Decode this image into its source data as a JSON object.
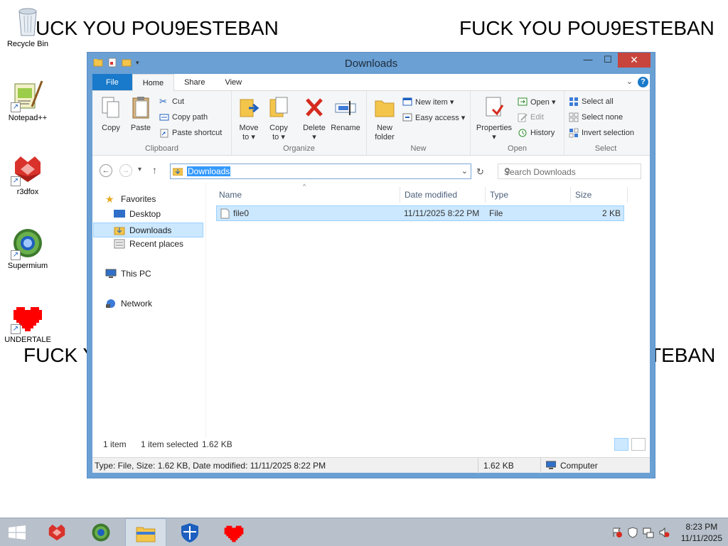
{
  "wallpaper": {
    "line1": "UCK YOU POU9ESTEBAN",
    "line2": "FUCK YOU POU9ESTEBAN",
    "line3": "FUCK Y",
    "line4": "TEBAN"
  },
  "desktop_icons": [
    {
      "label": "Recycle Bin",
      "icon": "recycle-bin-icon"
    },
    {
      "label": "Notepad++",
      "icon": "notepad-plus-plus-icon"
    },
    {
      "label": "r3dfox",
      "icon": "r3dfox-icon"
    },
    {
      "label": "Supermium",
      "icon": "supermium-icon"
    },
    {
      "label": "UNDERTALE",
      "icon": "undertale-heart-icon"
    }
  ],
  "window": {
    "title": "Downloads",
    "minimize": "—",
    "maximize": "☐",
    "close": "✕"
  },
  "ribbon_tabs": [
    "File",
    "Home",
    "Share",
    "View"
  ],
  "ribbon": {
    "clipboard": {
      "label": "Clipboard",
      "copy": "Copy",
      "paste": "Paste",
      "cut": "Cut",
      "copy_path": "Copy path",
      "paste_shortcut": "Paste shortcut"
    },
    "organize": {
      "label": "Organize",
      "move_to": "Move",
      "move_to2": "to ▾",
      "copy_to": "Copy",
      "copy_to2": "to ▾",
      "delete": "Delete",
      "delete2": "▾",
      "rename": "Rename"
    },
    "new": {
      "label": "New",
      "new_folder": "New",
      "new_folder2": "folder",
      "new_item": "New item ▾",
      "easy_access": "Easy access ▾"
    },
    "open": {
      "label": "Open",
      "properties": "Properties",
      "properties2": "▾",
      "open": "Open ▾",
      "edit": "Edit",
      "history": "History"
    },
    "select": {
      "label": "Select",
      "select_all": "Select all",
      "select_none": "Select none",
      "invert": "Invert selection"
    }
  },
  "address": {
    "path": "Downloads",
    "search_placeholder": "Search Downloads"
  },
  "nav": {
    "favorites": "Favorites",
    "desktop": "Desktop",
    "downloads": "Downloads",
    "recent": "Recent places",
    "this_pc": "This PC",
    "network": "Network"
  },
  "columns": {
    "name": "Name",
    "date": "Date modified",
    "type": "Type",
    "size": "Size"
  },
  "files": [
    {
      "name": "file0",
      "date": "11/11/2025 8:22 PM",
      "type": "File",
      "size": "2 KB"
    }
  ],
  "status": {
    "count": "1 item",
    "selected": "1 item selected",
    "selected_size": "1.62 KB",
    "details": "Type: File, Size: 1.62 KB, Date modified: 11/11/2025 8:22 PM",
    "size": "1.62 KB",
    "location": "Computer"
  },
  "taskbar": {
    "time": "8:23 PM",
    "date": "11/11/2025"
  },
  "colors": {
    "accent": "#1979ca",
    "window_frame": "#6aa0d4",
    "selection": "#cce8ff",
    "close_red": "#c7453c"
  }
}
